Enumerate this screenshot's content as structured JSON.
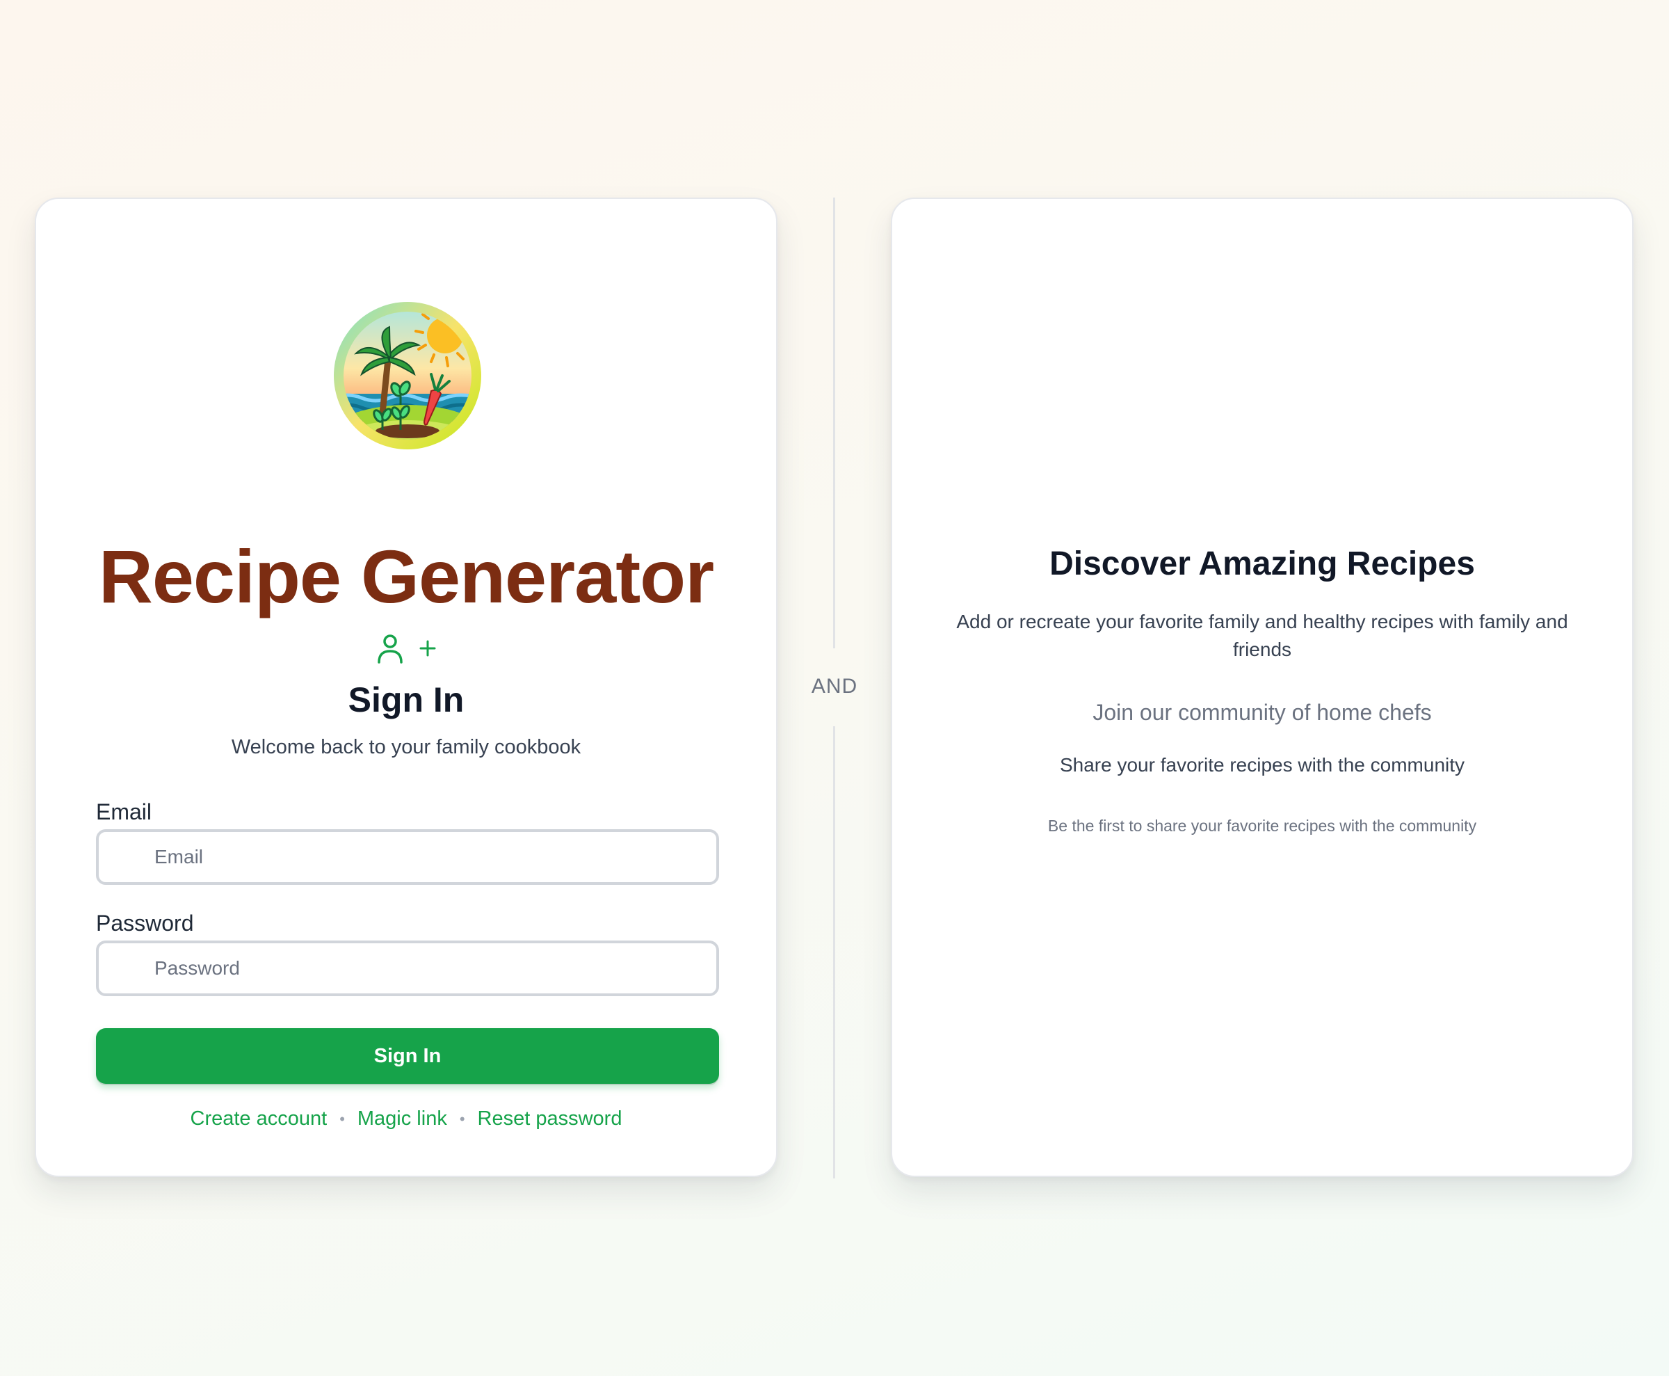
{
  "signin_card": {
    "logo_name": "recipe-generator-logo",
    "app_title": "Recipe Generator",
    "icons": [
      "user-icon",
      "plus-icon"
    ],
    "heading": "Sign In",
    "subtitle": "Welcome back to your family cookbook",
    "email": {
      "label": "Email",
      "placeholder": "Email",
      "value": ""
    },
    "password": {
      "label": "Password",
      "placeholder": "Password",
      "value": ""
    },
    "submit_label": "Sign In",
    "links": {
      "create_account": "Create account",
      "magic_link": "Magic link",
      "reset_password": "Reset password"
    }
  },
  "divider": {
    "label": "AND"
  },
  "discover_card": {
    "title": "Discover Amazing Recipes",
    "description": "Add or recreate your favorite family and healthy recipes with family and friends",
    "community": "Join our community of home chefs",
    "share": "Share your favorite recipes with the community",
    "first": "Be the first to share your favorite recipes with the community"
  },
  "colors": {
    "title": "#7c2d12",
    "accent": "#16a34a",
    "heading": "#111827"
  }
}
